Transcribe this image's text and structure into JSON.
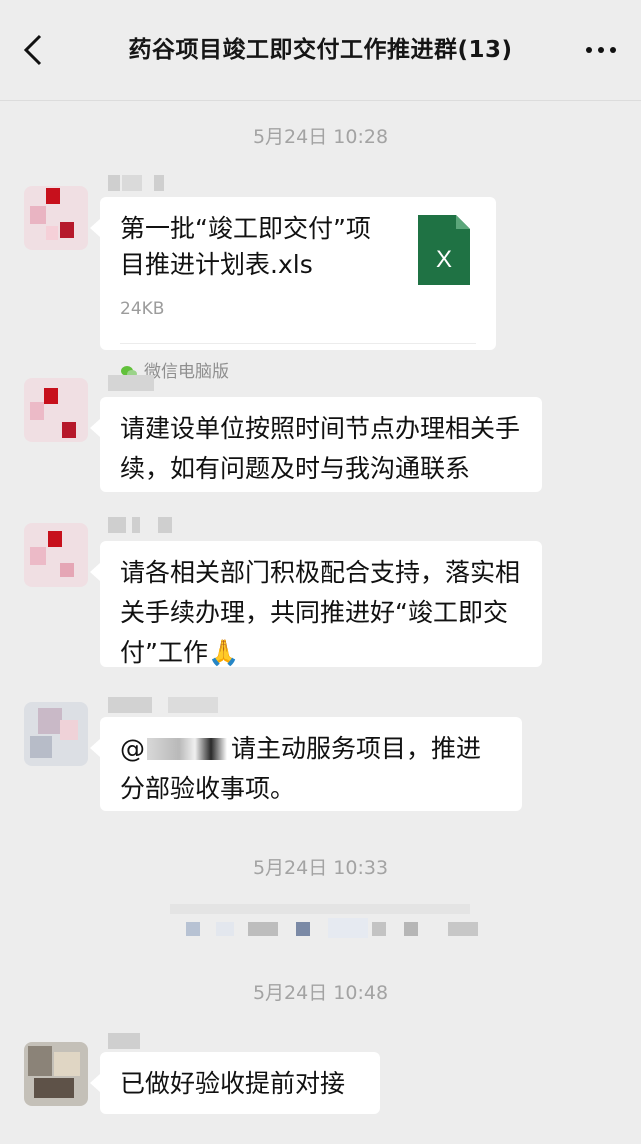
{
  "header": {
    "title": "药谷项目竣工即交付工作推进群(13)"
  },
  "timestamps": [
    "5月24日 10:28",
    "5月24日 10:33",
    "5月24日 10:48"
  ],
  "messages": {
    "file": {
      "name": "第一批“竣工即交付”项目推进计划表.xls",
      "size": "24KB",
      "source": "微信电脑版",
      "icon": "excel-file-icon",
      "icon_letter": "X",
      "icon_color": "#1f7244"
    },
    "msg1": "请建设单位按照时间节点办理相关手续，如有问题及时与我沟通联系",
    "msg2": "请各相关部门积极配合支持，落实相关手续办理，共同推进好“竣工即交付”工作🙏",
    "msg3_prefix": "@",
    "msg3": "请主动服务项目，推进分部验收事项。",
    "msg4": "已做好验收提前对接"
  },
  "colors": {
    "background": "#ededed",
    "bubble": "#ffffff",
    "timestamp": "#a3a3a3"
  }
}
